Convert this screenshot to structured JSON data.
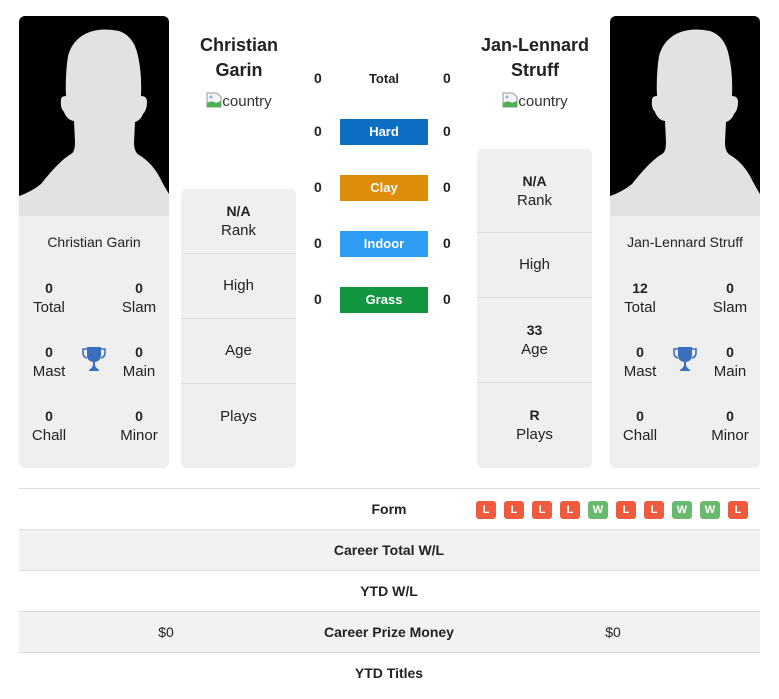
{
  "players": [
    {
      "name": "Christian Garin",
      "header_name_line1": "Christian",
      "header_name_line2": "Garin",
      "flag_alt": "country",
      "titles": {
        "total": {
          "value": "0",
          "label": "Total"
        },
        "slam": {
          "value": "0",
          "label": "Slam"
        },
        "mast": {
          "value": "0",
          "label": "Mast"
        },
        "main": {
          "value": "0",
          "label": "Main"
        },
        "chall": {
          "value": "0",
          "label": "Chall"
        },
        "minor": {
          "value": "0",
          "label": "Minor"
        }
      },
      "info": {
        "rank": {
          "value": "N/A",
          "label": "Rank"
        },
        "high": {
          "value": "",
          "label": "High"
        },
        "age": {
          "value": "",
          "label": "Age"
        },
        "plays": {
          "value": "",
          "label": "Plays"
        }
      }
    },
    {
      "name": "Jan-Lennard Struff",
      "header_name_line1": "Jan-Lennard",
      "header_name_line2": "Struff",
      "flag_alt": "country",
      "titles": {
        "total": {
          "value": "12",
          "label": "Total"
        },
        "slam": {
          "value": "0",
          "label": "Slam"
        },
        "mast": {
          "value": "0",
          "label": "Mast"
        },
        "main": {
          "value": "0",
          "label": "Main"
        },
        "chall": {
          "value": "0",
          "label": "Chall"
        },
        "minor": {
          "value": "0",
          "label": "Minor"
        }
      },
      "info": {
        "rank": {
          "value": "N/A",
          "label": "Rank"
        },
        "high": {
          "value": "",
          "label": "High"
        },
        "age": {
          "value": "33",
          "label": "Age"
        },
        "plays": {
          "value": "R",
          "label": "Plays"
        }
      }
    }
  ],
  "h2h": [
    {
      "label": "Total",
      "left": "0",
      "right": "0",
      "color": null
    },
    {
      "label": "Hard",
      "left": "0",
      "right": "0",
      "color": "#0d6fc4"
    },
    {
      "label": "Clay",
      "left": "0",
      "right": "0",
      "color": "#de8c0b"
    },
    {
      "label": "Indoor",
      "left": "0",
      "right": "0",
      "color": "#2f9cf3"
    },
    {
      "label": "Grass",
      "left": "0",
      "right": "0",
      "color": "#139640"
    }
  ],
  "comparison": {
    "form": {
      "label": "Form",
      "right_results": [
        "L",
        "L",
        "L",
        "L",
        "W",
        "L",
        "L",
        "W",
        "W",
        "L"
      ]
    },
    "career_total_wl": {
      "label": "Career Total W/L",
      "left": "",
      "right": ""
    },
    "ytd_wl": {
      "label": "YTD W/L",
      "left": "",
      "right": ""
    },
    "career_prize_money": {
      "label": "Career Prize Money",
      "left": "$0",
      "right": "$0"
    },
    "ytd_titles": {
      "label": "YTD Titles",
      "left": "",
      "right": ""
    }
  },
  "colors": {
    "win": "#6ab96f",
    "loss": "#ee5b3f",
    "trophy": "#3b6fbd"
  }
}
